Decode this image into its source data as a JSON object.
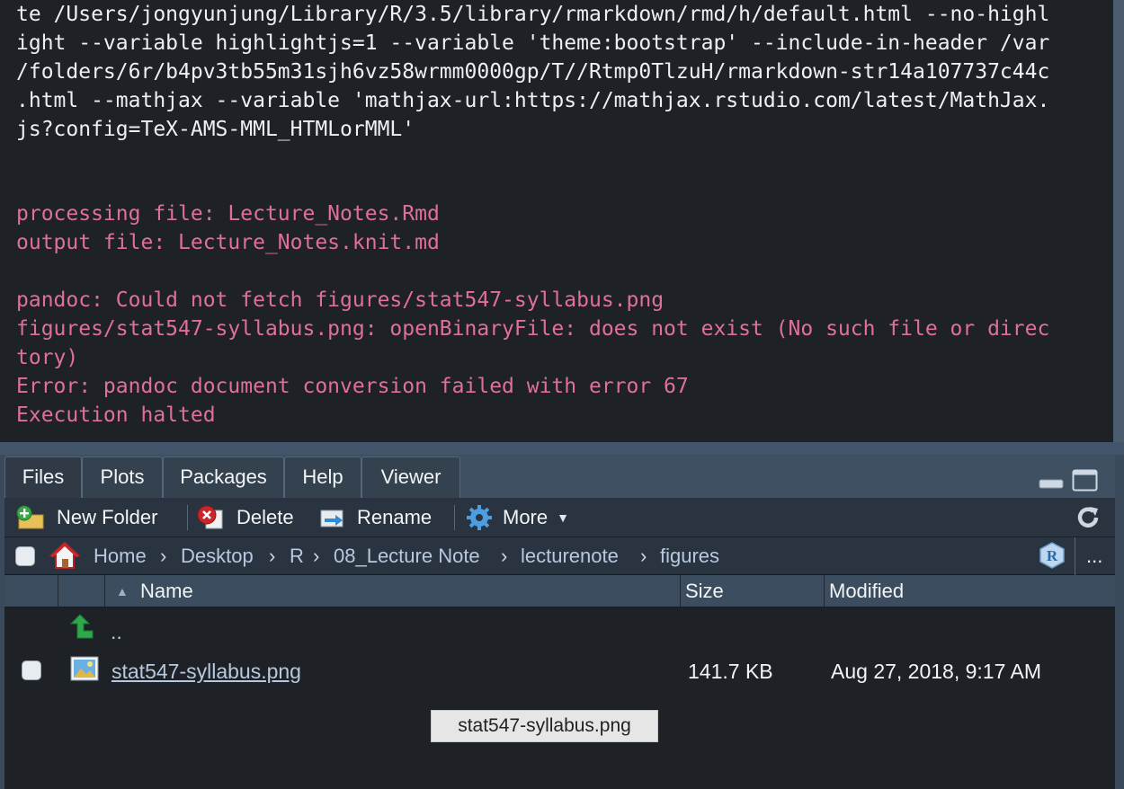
{
  "console": {
    "lines": [
      "te /Users/jongyunjung/Library/R/3.5/library/rmarkdown/rmd/h/default.html --no-highl",
      "ight --variable highlightjs=1 --variable 'theme:bootstrap' --include-in-header /var",
      "/folders/6r/b4pv3tb55m31sjh6vz58wrmm0000gp/T//Rtmp0TlzuH/rmarkdown-str14a107737c44c",
      ".html --mathjax --variable 'mathjax-url:https://mathjax.rstudio.com/latest/MathJax.",
      "js?config=TeX-AMS-MML_HTMLorMML'"
    ],
    "processing": "processing file: Lecture_Notes.Rmd",
    "output": "output file: Lecture_Notes.knit.md",
    "errors": [
      "pandoc: Could not fetch figures/stat547-syllabus.png",
      "figures/stat547-syllabus.png: openBinaryFile: does not exist (No such file or direc",
      "tory)",
      "Error: pandoc document conversion failed with error 67",
      "Execution halted"
    ]
  },
  "tabs": [
    {
      "label": "Files",
      "active": true
    },
    {
      "label": "Plots"
    },
    {
      "label": "Packages"
    },
    {
      "label": "Help"
    },
    {
      "label": "Viewer"
    }
  ],
  "toolbar": {
    "new_folder": "New Folder",
    "delete": "Delete",
    "rename": "Rename",
    "more": "More"
  },
  "breadcrumb": [
    "Home",
    "Desktop",
    "R",
    "08_Lecture Note",
    "lecturenote",
    "figures"
  ],
  "breadcrumb_extra": "...",
  "columns": {
    "name": "Name",
    "size": "Size",
    "modified": "Modified"
  },
  "parent_dir": "..",
  "files": [
    {
      "name": "stat547-syllabus.png",
      "size": "141.7 KB",
      "modified": "Aug 27, 2018, 9:17 AM"
    }
  ],
  "tooltip": "stat547-syllabus.png",
  "colors": {
    "console_bg": "#1e2125",
    "error_text": "#e0709a",
    "link": "#b7c9e0"
  },
  "icons": {
    "new_folder": "new-folder-icon",
    "delete": "delete-icon",
    "rename": "rename-icon",
    "more": "gear-icon",
    "refresh": "refresh-icon",
    "home": "home-icon",
    "r_project": "r-project-icon",
    "parent": "up-arrow-icon",
    "file": "image-file-icon"
  }
}
